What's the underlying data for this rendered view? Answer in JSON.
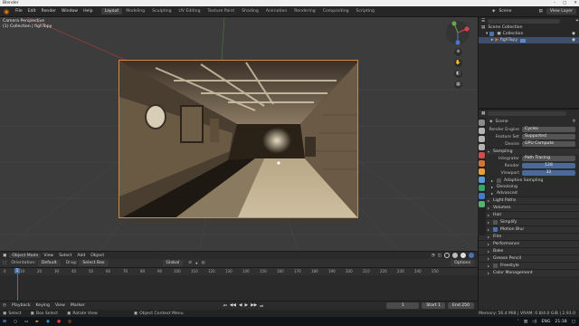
{
  "window": {
    "title": "Blender"
  },
  "menubar": {
    "menus": [
      "File",
      "Edit",
      "Render",
      "Window",
      "Help"
    ],
    "workspaces": [
      "Layout",
      "Modeling",
      "Sculpting",
      "UV Editing",
      "Texture Paint",
      "Shading",
      "Animation",
      "Rendering",
      "Compositing",
      "Scripting"
    ],
    "active_workspace": "Layout",
    "scene": "Scene",
    "view_layer": "View Layer"
  },
  "viewport": {
    "camera_label": "Camera Perspective",
    "collection_label": "(1) Collection | fighTopy"
  },
  "vp_header": {
    "mode": "Object Mode",
    "items": [
      "View",
      "Select",
      "Add",
      "Object"
    ],
    "orientation_label": "Orientation:",
    "orientation_value": "Default",
    "drag_label": "Drag:",
    "drag_value": "Select Box",
    "transform": "Global",
    "options": "Options"
  },
  "timeline": {
    "ticks": [
      "0",
      "10",
      "20",
      "30",
      "40",
      "50",
      "60",
      "70",
      "80",
      "90",
      "100",
      "110",
      "120",
      "130",
      "140",
      "150",
      "160",
      "170",
      "180",
      "190",
      "200",
      "210",
      "220",
      "230",
      "240",
      "250"
    ],
    "current_frame": "1",
    "playback": "Playback",
    "keying": "Keying",
    "view": "View",
    "marker": "Marker",
    "frame_value": "1",
    "start_label": "Start",
    "start_value": "1",
    "end_label": "End",
    "end_value": "250"
  },
  "statusbar": {
    "select": "Select",
    "box_select": "Box Select",
    "rotate_view": "Rotate View",
    "context_menu": "Object Context Menu",
    "memory": "Memory: 56.4 MiB | VRAM: 0.8/4.0 GiB | 2.93.0"
  },
  "taskbar": {
    "lang": "ENG",
    "time": "21:38"
  },
  "outliner": {
    "root": "Scene Collection",
    "collection": "Collection",
    "object": "fighTopy"
  },
  "properties": {
    "scene_name": "Scene",
    "render_engine_label": "Render Engine",
    "render_engine": "Cycles",
    "feature_set_label": "Feature Set",
    "feature_set": "Supported",
    "device_label": "Device",
    "device": "GPU Compute",
    "sampling": "Sampling",
    "integrator_label": "Integrator",
    "integrator": "Path Tracing",
    "render_label": "Render",
    "render_samples": "128",
    "viewport_label": "Viewport",
    "viewport_samples": "32",
    "adaptive": "Adaptive Sampling",
    "denoising": "Denoising",
    "advanced": "Advanced",
    "panels": [
      "Light Paths",
      "Volumes",
      "Hair",
      "Simplify",
      "Motion Blur",
      "Film",
      "Performance",
      "Bake",
      "Grease Pencil",
      "Freestyle",
      "Color Management"
    ]
  },
  "colors": {
    "accent": "#e87d0d",
    "selection": "#4a73b3",
    "frame": "#d9883a"
  }
}
